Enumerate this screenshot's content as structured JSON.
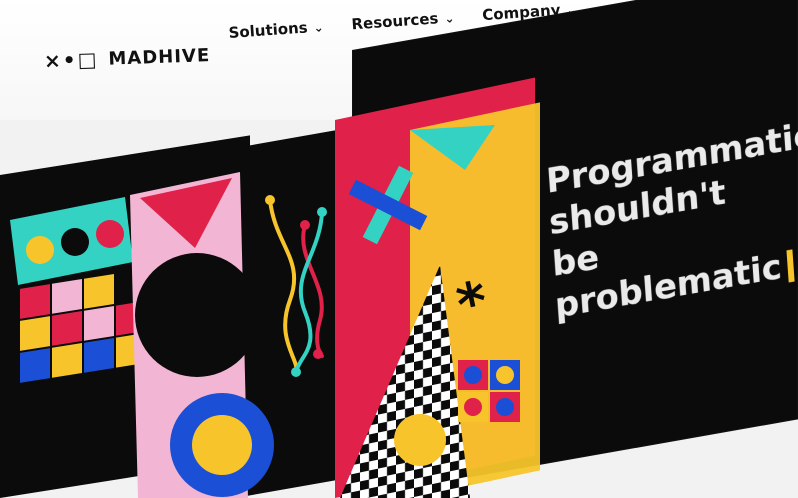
{
  "header": {
    "brand": "MADHIVE",
    "logo_mark": "×•□",
    "nav": [
      {
        "label": "Solutions",
        "icon": "chevron-down-icon"
      },
      {
        "label": "Resources",
        "icon": "chevron-down-icon"
      },
      {
        "label": "Company",
        "icon": "chevron-down-icon"
      }
    ]
  },
  "hero": {
    "lines": [
      "Programmatic",
      "shouldn't",
      "be problematic"
    ]
  },
  "colors": {
    "accent_red": "#e0214a",
    "accent_yellow": "#f7c52b",
    "accent_blue": "#1b4fd6",
    "accent_aqua": "#33d2c2",
    "accent_pink": "#f2b5d3",
    "black": "#0b0b0b"
  }
}
